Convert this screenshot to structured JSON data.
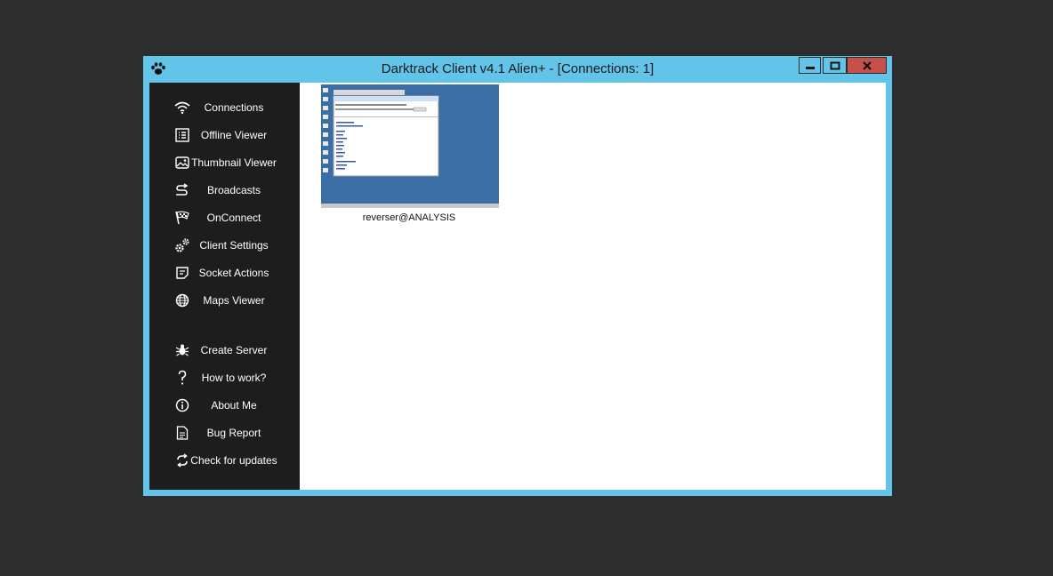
{
  "window": {
    "title": "Darktrack Client v4.1 Alien+ - [Connections: 1]"
  },
  "sidebar": {
    "items": [
      {
        "label": "Connections",
        "icon": "wifi-icon"
      },
      {
        "label": "Offline Viewer",
        "icon": "list-icon"
      },
      {
        "label": "Thumbnail Viewer",
        "icon": "picture-icon"
      },
      {
        "label": "Broadcasts",
        "icon": "broadcast-arrow-icon"
      },
      {
        "label": "OnConnect",
        "icon": "checkered-flag-icon"
      },
      {
        "label": "Client Settings",
        "icon": "gears-icon"
      },
      {
        "label": "Socket Actions",
        "icon": "note-icon"
      },
      {
        "label": "Maps Viewer",
        "icon": "globe-icon"
      },
      {
        "label": "Create Server",
        "icon": "bug-icon"
      },
      {
        "label": "How to work?",
        "icon": "question-icon"
      },
      {
        "label": "About Me",
        "icon": "info-icon"
      },
      {
        "label": "Bug Report",
        "icon": "report-icon"
      },
      {
        "label": "Check for updates",
        "icon": "refresh-icon"
      }
    ]
  },
  "connections": [
    {
      "caption": "reverser@ANALYSIS"
    }
  ],
  "colors": {
    "frame": "#62c4e8",
    "sidebar": "#1d1d1d",
    "close": "#c7504a",
    "desktop": "#3b6ea5"
  }
}
